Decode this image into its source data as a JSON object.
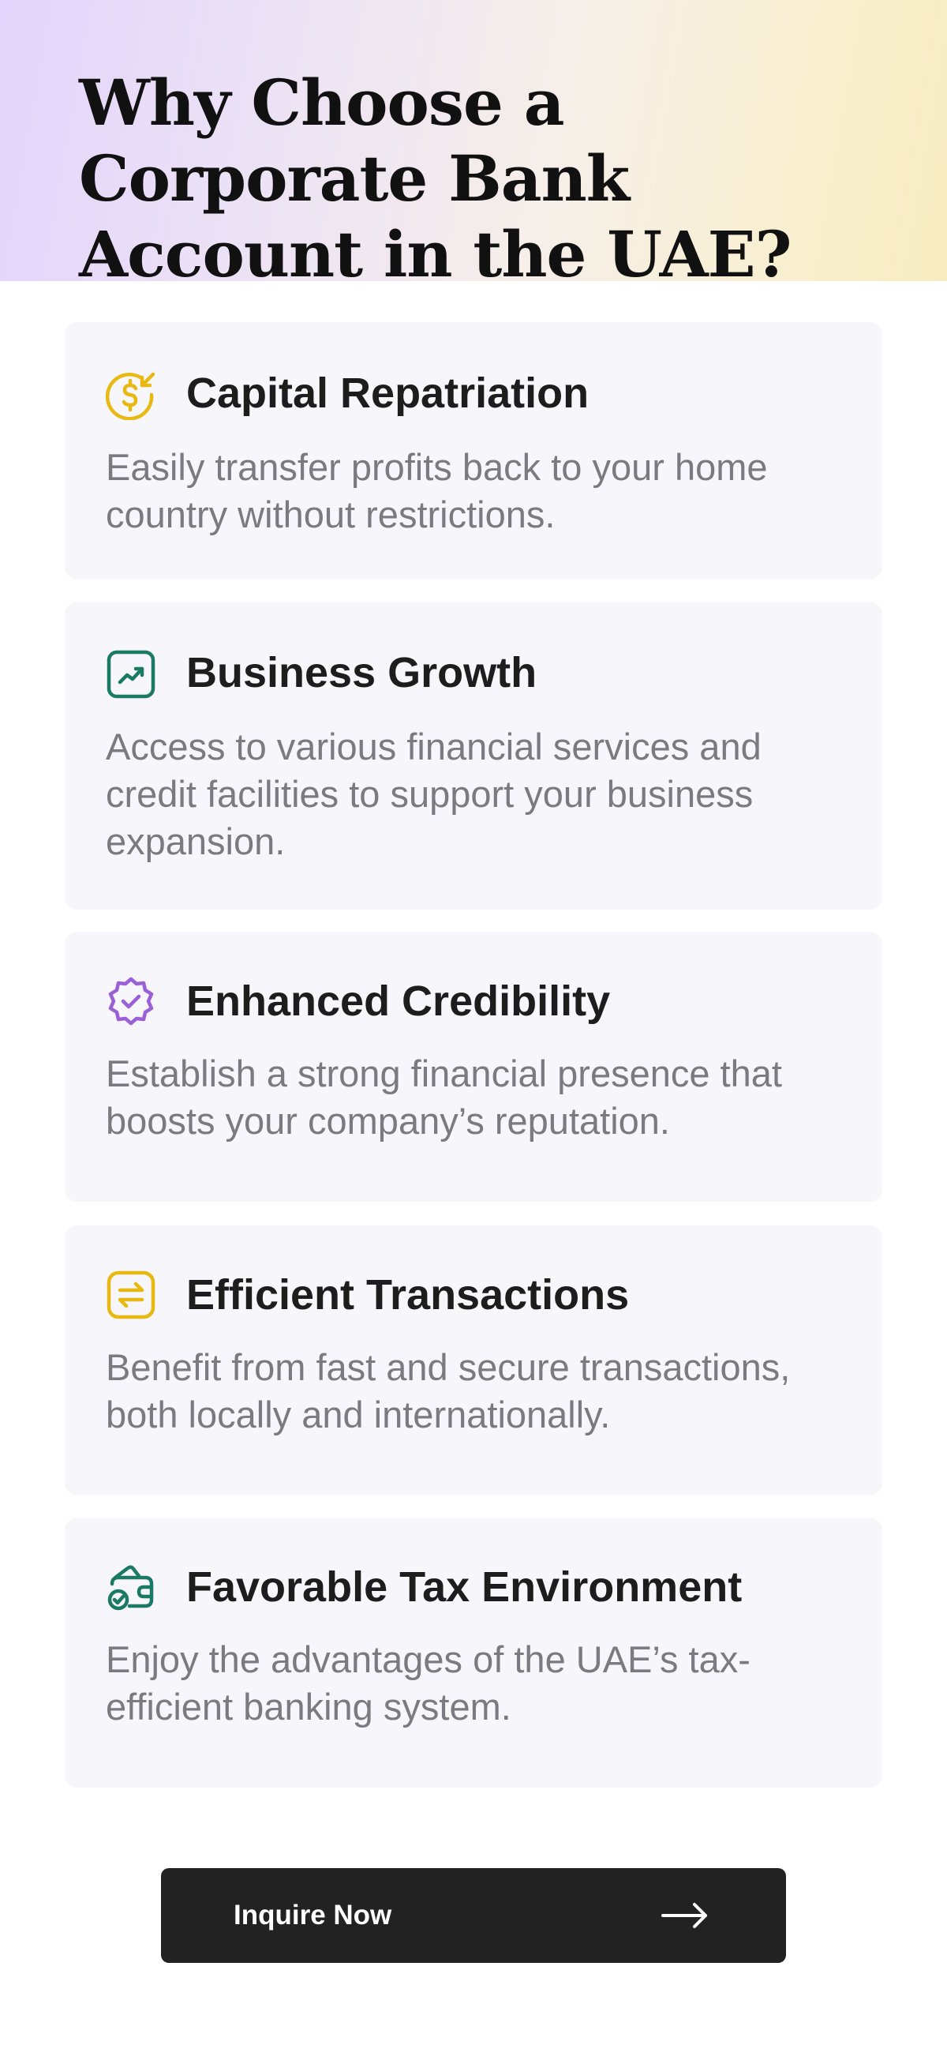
{
  "header": {
    "title": "Why Choose a Corporate Bank Account in the UAE?"
  },
  "benefits": [
    {
      "icon": "dollar-repatriation-icon",
      "icon_color": "#e8b913",
      "title": "Capital Repatriation",
      "description": "Easily transfer profits back to your home country without restrictions."
    },
    {
      "icon": "trend-up-icon",
      "icon_color": "#1b7a63",
      "title": "Business Growth",
      "description": "Access to various financial services and credit facilities to support your business expansion."
    },
    {
      "icon": "verified-badge-icon",
      "icon_color": "#9b5fd6",
      "title": "Enhanced Credibility",
      "description": "Establish a strong financial presence that boosts your company’s reputation."
    },
    {
      "icon": "transfer-arrows-icon",
      "icon_color": "#e8b913",
      "title": "Efficient Transactions",
      "description": "Benefit from fast and secure transactions, both locally and internationally."
    },
    {
      "icon": "wallet-check-icon",
      "icon_color": "#1b7a63",
      "title": "Favorable Tax Environment",
      "description": "Enjoy the advantages of the UAE’s tax-efficient banking system."
    }
  ],
  "cta": {
    "label": "Inquire Now",
    "icon": "arrow-right-icon"
  }
}
